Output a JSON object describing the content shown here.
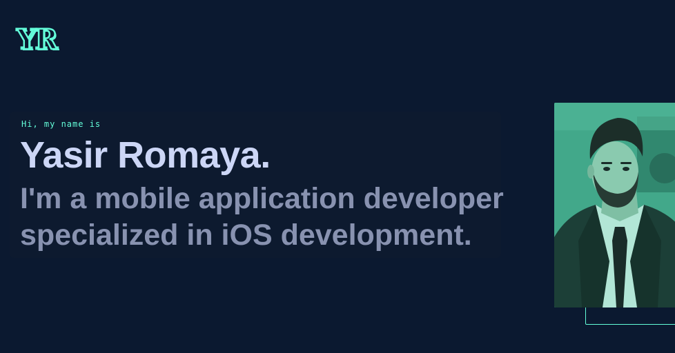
{
  "header": {
    "logo_text": "YR"
  },
  "hero": {
    "greeting": "Hi, my name is",
    "name": "Yasir Romaya.",
    "tagline": "I'm a mobile application developer specialized in iOS development."
  },
  "profile_photo": {
    "alt": "Yasir Romaya"
  },
  "colors": {
    "background": "#0b1930",
    "accent": "#64ffda",
    "heading": "#ccd6f6",
    "subheading": "#8892b0"
  }
}
